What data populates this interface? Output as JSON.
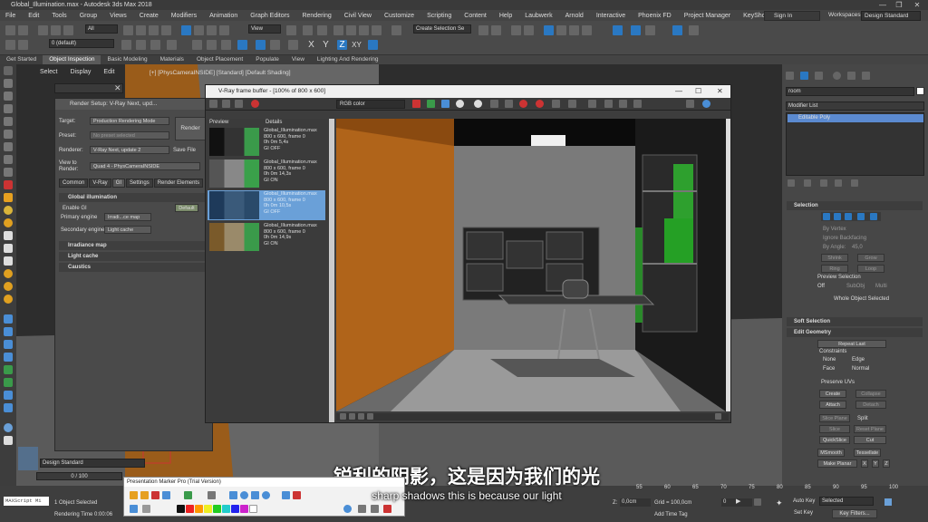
{
  "app": {
    "title": "Global_Illumination.max - Autodesk 3ds Max 2018"
  },
  "menu": [
    "File",
    "Edit",
    "Tools",
    "Group",
    "Views",
    "Create",
    "Modifiers",
    "Animation",
    "Graph Editors",
    "Rendering",
    "Civil View",
    "Customize",
    "Scripting",
    "Content",
    "Help",
    "Laubwerk",
    "Arnold",
    "Interactive",
    "Phoenix FD",
    "Project Manager",
    "KeyShot 8"
  ],
  "signin": {
    "label": "Sign In",
    "workspaces_label": "Workspaces:",
    "workspace_value": "Design Standard"
  },
  "toolbar": {
    "selection_filter": "All",
    "view_dropdown": "View",
    "named_selection": "Create Selection Se",
    "layer": "0 (default)"
  },
  "ribbon_tabs": [
    "Get Started",
    "Object Inspection",
    "Basic Modeling",
    "Materials",
    "Object Placement",
    "Populate",
    "View",
    "Lighting And Rendering"
  ],
  "ribbon_active": "Object Inspection",
  "scene_menu": [
    "Select",
    "Display",
    "Edit"
  ],
  "viewport": {
    "label": "[+] [PhysCameraINSIDE] [Standard] [Default Shading]"
  },
  "render_setup": {
    "title": "Render Setup: V-Ray Next, upd...",
    "target_label": "Target:",
    "target_value": "Production Rendering Mode",
    "preset_label": "Preset:",
    "preset_value": "No preset selected",
    "renderer_label": "Renderer:",
    "renderer_value": "V-Ray Next, update 2",
    "save_file": "Save File",
    "view_label": "View to Render:",
    "view_value": "Quad 4 - PhysCameraINSIDE",
    "render_button": "Render",
    "tabs": [
      "Common",
      "V-Ray",
      "GI",
      "Settings",
      "Render Elements"
    ],
    "active_tab": "GI",
    "gi_rollout": "Global illumination",
    "enable_gi": "Enable GI",
    "default_btn": "Default",
    "primary_label": "Primary engine",
    "primary_value": "Irradi...ce map",
    "secondary_label": "Secondary engine",
    "secondary_value": "Light cache",
    "rollouts": [
      "Irradiance map",
      "Light cache",
      "Caustics"
    ]
  },
  "vfb": {
    "title": "V-Ray frame buffer - [100% of 800 x 600]",
    "channel": "RGB color",
    "history_headers": [
      "Preview",
      "Details"
    ],
    "history": [
      {
        "line1": "Global_Illumination.max",
        "line2": "800 x 600, frame 0",
        "line3": "0h 0m 5,4s",
        "line4": "GI OFF"
      },
      {
        "line1": "Global_Illumination.max",
        "line2": "800 x 600, frame 0",
        "line3": "0h 0m 14,3s",
        "line4": "GI ON"
      },
      {
        "line1": "Global_Illumination.max",
        "line2": "800 x 600, frame 0",
        "line3": "0h 0m 10,5s",
        "line4": "GI OFF"
      },
      {
        "line1": "Global_Illumination.max",
        "line2": "800 x 600, frame 0",
        "line3": "0h 0m 14,9s",
        "line4": "GI ON"
      }
    ]
  },
  "command_panel": {
    "object_name": "room",
    "modifier_list": "Modifier List",
    "stack_item": "Editable Poly",
    "selection": "Selection",
    "by_vertex": "By Vertex",
    "ignore_backfacing": "Ignore Backfacing",
    "by_angle": "By Angle:",
    "by_angle_value": "45,0",
    "shrink": "Shrink",
    "grow": "Grow",
    "ring": "Ring",
    "loop": "Loop",
    "preview_selection": "Preview Selection",
    "off": "Off",
    "subobj": "SubObj",
    "multi": "Multi",
    "whole_object": "Whole Object Selected",
    "soft_selection": "Soft Selection",
    "edit_geometry": "Edit Geometry",
    "repeat_last": "Repeat Last",
    "constraints": "Constraints",
    "none": "None",
    "edge": "Edge",
    "face": "Face",
    "normal": "Normal",
    "preserve_uvs": "Preserve UVs",
    "create": "Create",
    "collapse": "Collapse",
    "attach": "Attach",
    "detach": "Detach",
    "slice_plane": "Slice Plane",
    "split": "Split",
    "slice": "Slice",
    "reset_plane": "Reset Plane",
    "quickslice": "QuickSlice",
    "cut": "Cut",
    "msmooth": "MSmooth",
    "tessellate": "Tessellate",
    "make_planar": "Make Planar",
    "x": "X",
    "y": "Y",
    "z": "Z"
  },
  "status": {
    "design_standard": "Design Standard",
    "frame": "0 / 100",
    "selected": "1 Object Selected",
    "rendering_time": "Rendering Time  0:00:06",
    "maxscript": "MAXScript Mi",
    "z_label": "Z:",
    "z_value": "0,0cm",
    "grid": "Grid = 100,0cm",
    "add_time_tag": "Add Time Tag",
    "auto_key": "Auto Key",
    "selected_dd": "Selected",
    "set_key": "Set Key",
    "key_filters": "Key Filters...",
    "frame_spinner": "0"
  },
  "timeline_ticks": [
    "55",
    "60",
    "65",
    "70",
    "75",
    "80",
    "85",
    "90",
    "95",
    "100"
  ],
  "marker": {
    "title": "Presentation Marker Pro (Trial Version)"
  },
  "subtitles": {
    "cn": "锐利的阴影，这是因为我们的光",
    "en": "sharp shadows this is because our light"
  }
}
